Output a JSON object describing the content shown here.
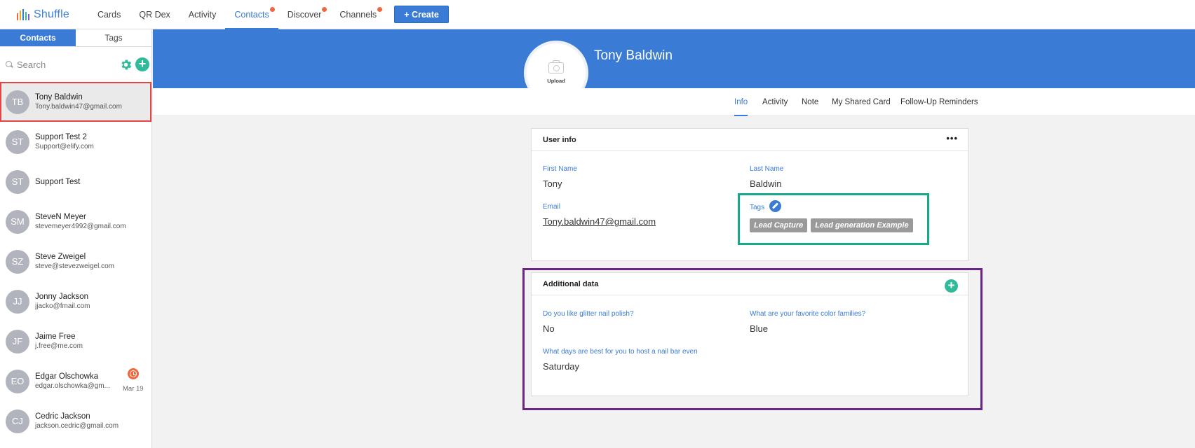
{
  "brand": {
    "name": "Shuffle",
    "accent": "#3a7bd5"
  },
  "nav": {
    "items": [
      {
        "label": "Cards",
        "dot": false,
        "active": false
      },
      {
        "label": "QR Dex",
        "dot": false,
        "active": false
      },
      {
        "label": "Activity",
        "dot": false,
        "active": false
      },
      {
        "label": "Contacts",
        "dot": true,
        "active": true
      },
      {
        "label": "Discover",
        "dot": true,
        "active": false
      },
      {
        "label": "Channels",
        "dot": true,
        "active": false
      }
    ],
    "create_label": "+ Create"
  },
  "sidebar": {
    "tabs": [
      "Contacts",
      "Tags"
    ],
    "search_placeholder": "Search",
    "contacts": [
      {
        "initials": "TB",
        "name": "Tony Baldwin",
        "email": "Tony.baldwin47@gmail.com",
        "selected": true
      },
      {
        "initials": "ST",
        "name": "Support Test 2",
        "email": "Support@elify.com"
      },
      {
        "initials": "ST",
        "name": "Support Test",
        "email": ""
      },
      {
        "initials": "SM",
        "name": "SteveN Meyer",
        "email": "stevemeyer4992@gmail.com"
      },
      {
        "initials": "SZ",
        "name": "Steve Zweigel",
        "email": "steve@stevezweigel.com"
      },
      {
        "initials": "JJ",
        "name": "Jonny Jackson",
        "email": "jjacko@fmail.com"
      },
      {
        "initials": "JF",
        "name": "Jaime Free",
        "email": "j.free@me.com"
      },
      {
        "initials": "EO",
        "name": "Edgar Olschowka",
        "email": "edgar.olschowka@gm...",
        "reminder": true,
        "date": "Mar 19"
      },
      {
        "initials": "CJ",
        "name": "Cedric Jackson",
        "email": "jackson.cedric@gmail.com"
      }
    ]
  },
  "profile": {
    "name": "Tony Baldwin",
    "upload_label": "Upload",
    "tabs": [
      "Info",
      "Activity",
      "Note",
      "My Shared Card",
      "Follow-Up Reminders"
    ],
    "active_tab": "Info"
  },
  "user_info": {
    "title": "User info",
    "first_name_label": "First Name",
    "first_name": "Tony",
    "last_name_label": "Last Name",
    "last_name": "Baldwin",
    "email_label": "Email",
    "email": "Tony.baldwin47@gmail.com",
    "tags_label": "Tags",
    "tags": [
      "Lead Capture",
      "Lead generation Example"
    ]
  },
  "additional_data": {
    "title": "Additional data",
    "q1_label": "Do you like glitter nail polish?",
    "q1_value": "No",
    "q2_label": "What are your favorite color families?",
    "q2_value": "Blue",
    "q3_label": "What days are best for you to host a nail bar even",
    "q3_value": "Saturday"
  }
}
